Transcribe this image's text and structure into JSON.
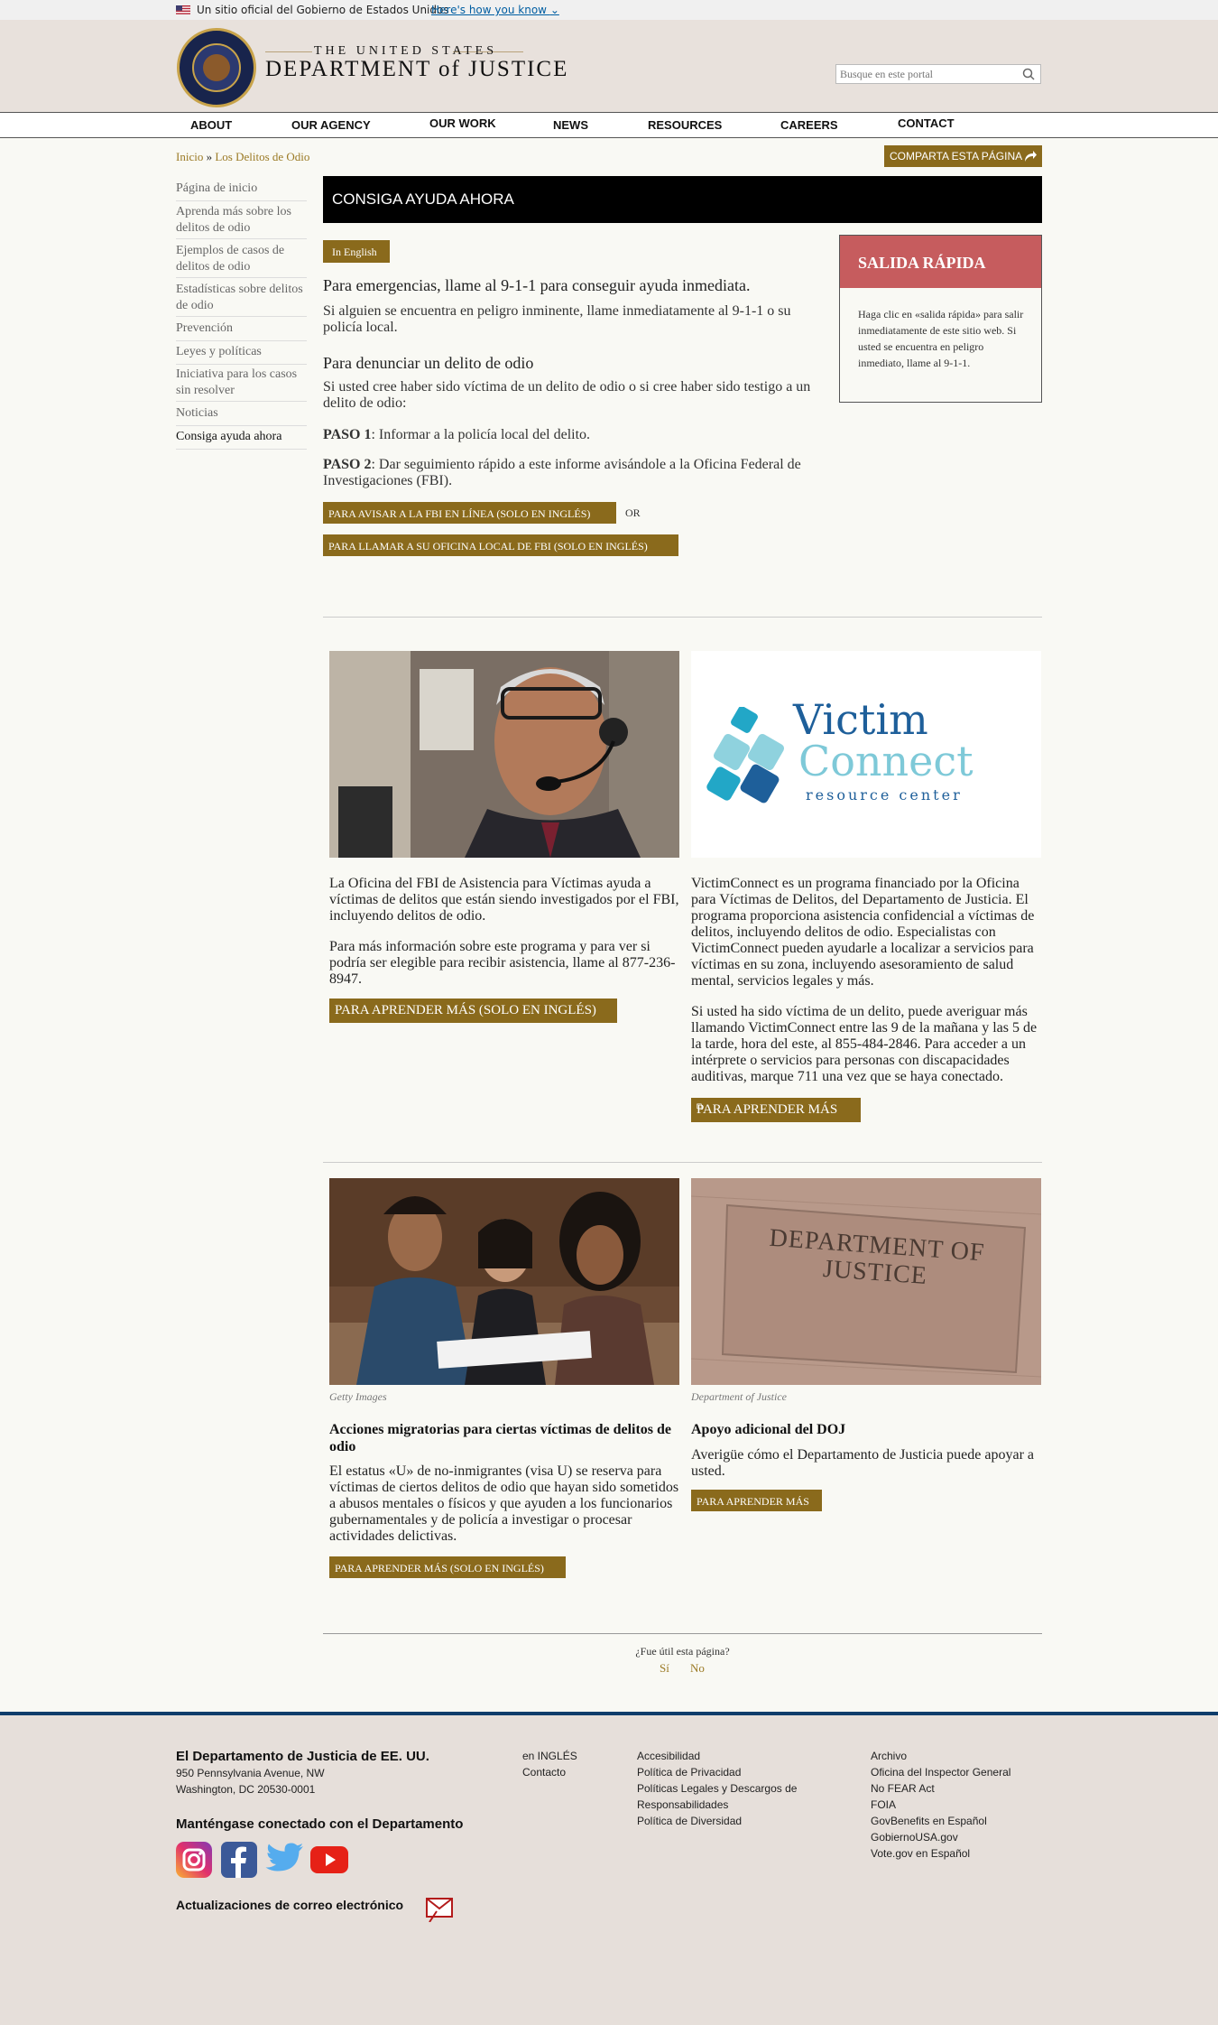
{
  "banner": {
    "text": "Un sitio oficial del Gobierno de Estados Unidos",
    "link": "Here's how you know"
  },
  "header": {
    "brand_top": "THE UNITED STATES",
    "brand_main": "DEPARTMENT of JUSTICE",
    "search_placeholder": "Busque en este portal"
  },
  "nav": [
    "ABOUT",
    "OUR AGENCY",
    "OUR WORK",
    "NEWS",
    "RESOURCES",
    "CAREERS",
    "CONTACT"
  ],
  "breadcrumb": {
    "home": "Inicio",
    "sep": "»",
    "current": "Los Delitos de Odio"
  },
  "share_label": "COMPARTA ESTA PÁGINA",
  "sidebar": [
    "Página de inicio",
    "Aprenda más sobre los delitos de odio",
    "Ejemplos de casos de delitos de odio",
    "Estadísticas sobre delitos de odio",
    "Prevención",
    "Leyes y políticas",
    "Iniciativa para los casos sin resolver",
    "Noticias",
    "Consiga ayuda ahora"
  ],
  "main": {
    "title": "CONSIGA AYUDA AHORA",
    "english_btn": "In English",
    "emergency_heading": "Para emergencias, llame al 9-1-1 para conseguir ayuda inmediata.",
    "emergency_text": "Si alguien se encuentra en peligro inminente, llame inmediatamente al 9-1-1 o su policía local.",
    "report_heading": "Para denunciar un delito de odio",
    "report_text": "Si usted cree haber sido víctima de un delito de odio o si cree haber sido testigo a un delito de odio:",
    "step1_label": "PASO 1",
    "step1_text": ": Informar a la policía local del delito.",
    "step2_label": "PASO 2",
    "step2_text": ": Dar seguimiento rápido a este informe avisándole a la Oficina Federal de Investigaciones (FBI).",
    "fbi_online_btn": "PARA AVISAR A LA FBI EN LÍNEA (SOLO EN INGLÉS)",
    "or_text": "OR",
    "fbi_call_btn": "PARA LLAMAR A SU OFICINA LOCAL DE FBI (SOLO EN INGLÉS)"
  },
  "quick_exit": {
    "title": "SALIDA RÁPIDA",
    "text": "Haga clic en «salida rápida» para salir inmediatamente de este sitio web. Si usted se encuentra en peligro inmediato, llame al 9-1-1."
  },
  "cards": {
    "fbi": {
      "p1": "La Oficina del FBI de Asistencia para Víctimas ayuda a víctimas de delitos que están siendo investigados por el FBI, incluyendo delitos de odio.",
      "p2": "Para más información sobre este programa y para ver si podría ser elegible para recibir asistencia, llame al 877-236-8947.",
      "btn": "PARA APRENDER MÁS (SOLO EN INGLÉS)"
    },
    "victim": {
      "logo_line1": "Victim",
      "logo_line2": "Connect",
      "logo_line3": "resource center",
      "p1": "VictimConnect es un programa financiado por la Oficina para Víctimas de Delitos, del Departamento de Justicia. El programa proporciona asistencia confidencial a víctimas de delitos, incluyendo delitos de odio. Especialistas con VictimConnect pueden ayudarle a localizar a servicios para víctimas en su zona, incluyendo asesoramiento de salud mental, servicios legales y más.",
      "p2": "Si usted ha sido víctima de un delito, puede averiguar más llamando VictimConnect entre las 9 de la mañana y las 5 de la tarde, hora del este, al 855-484-2846. Para acceder a un intérprete o servicios para personas con discapacidades auditivas, marque 711 una vez que se haya conectado.",
      "btn": "PARA APRENDER MÁS"
    },
    "immigration": {
      "caption": "Getty Images",
      "title": "Acciones migratorias para ciertas víctimas de delitos de odio",
      "text": "El estatus «U» de no-inmigrantes (visa U) se reserva para víctimas de ciertos delitos de odio que hayan sido sometidos a abusos mentales o físicos y que ayuden a los funcionarios gubernamentales y de policía a investigar o procesar actividades delictivas.",
      "btn": "PARA APRENDER MÁS (SOLO EN INGLÉS)"
    },
    "doj": {
      "caption": "Department of Justice",
      "sign_text": "DEPARTMENT OF JUSTICE",
      "title": "Apoyo adicional del DOJ",
      "text": "Averigüe cómo el Departamento de Justicia puede apoyar a usted.",
      "btn": "PARA APRENDER MÁS"
    }
  },
  "feedback": {
    "question": "¿Fue útil esta página?",
    "yes": "Sí",
    "no": "No"
  },
  "footer": {
    "org": "El Departamento de Justicia de EE. UU.",
    "addr1": "950 Pennsylvania Avenue, NW",
    "addr2": "Washington, DC 20530-0001",
    "connect": "Manténgase conectado con el Departamento",
    "email_updates": "Actualizaciones de correo electrónico",
    "col1": [
      "en INGLÉS",
      "Contacto"
    ],
    "col2": [
      "Accesibilidad",
      "Política de Privacidad",
      "Políticas Legales y Descargos de",
      "Responsabilidades",
      "Política de Diversidad"
    ],
    "col3": [
      "Archivo",
      "Oficina del Inspector General",
      "No FEAR Act",
      "FOIA",
      "GovBenefits en Español",
      "GobiernoUSA.gov",
      "Vote.gov en Español"
    ]
  },
  "colors": {
    "accent": "#8a6a1c",
    "exit": "#c65c5e",
    "footer_rule": "#0f3d6b"
  }
}
